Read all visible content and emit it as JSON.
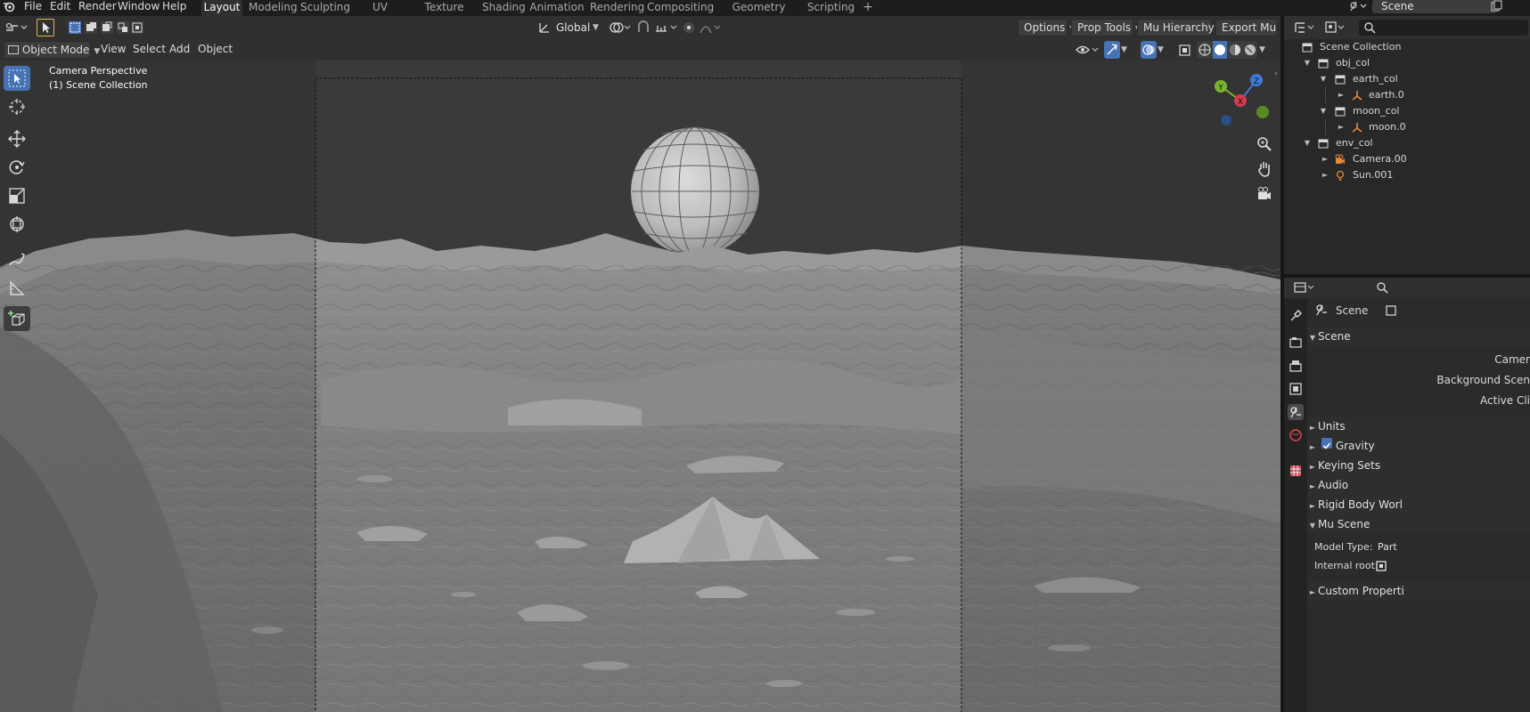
{
  "app": {
    "menu": [
      "File",
      "Edit",
      "Render",
      "Window",
      "Help"
    ],
    "workspace_tabs": [
      "Layout",
      "Modeling",
      "Sculpting",
      "UV Editing",
      "Texture Paint",
      "Shading",
      "Animation",
      "Rendering",
      "Compositing",
      "Geometry Nodes",
      "Scripting"
    ],
    "active_tab": "Layout",
    "add_tab_label": "+",
    "scene_name": "Scene"
  },
  "header": {
    "orientation": "Global",
    "right_buttons": [
      "Options",
      "Prop Tools",
      "Mu Hierarchy",
      "Export Mu"
    ]
  },
  "viewport_header": {
    "mode": "Object Mode",
    "menus": [
      "View",
      "Select",
      "Add",
      "Object"
    ]
  },
  "viewport": {
    "view_name": "Camera Perspective",
    "collection": "(1) Scene Collection",
    "gizmo": {
      "x": "X",
      "y": "Y",
      "z": "Z"
    }
  },
  "outliner": {
    "root": "Scene Collection",
    "items": [
      {
        "label": "obj_col",
        "type": "collection",
        "expanded": true
      },
      {
        "label": "earth_col",
        "type": "collection",
        "expanded": true
      },
      {
        "label": "earth.0",
        "type": "empty",
        "expanded": false
      },
      {
        "label": "moon_col",
        "type": "collection",
        "expanded": true
      },
      {
        "label": "moon.0",
        "type": "empty",
        "expanded": false
      },
      {
        "label": "env_col",
        "type": "collection",
        "expanded": true
      },
      {
        "label": "Camera.00",
        "type": "camera",
        "expanded": false
      },
      {
        "label": "Sun.001",
        "type": "light",
        "expanded": false
      }
    ]
  },
  "properties": {
    "context": "Scene",
    "section_scene": "Scene",
    "fields": {
      "camera": "Camer",
      "background_scene": "Background Scen",
      "active_clip": "Active Cli"
    },
    "sections": [
      "Units",
      "Gravity",
      "Keying Sets",
      "Audio",
      "Rigid Body Worl",
      "Mu Scene"
    ],
    "gravity_checked": true,
    "mu_scene": {
      "model_type_label": "Model Type:",
      "model_type_value": "Part",
      "internal_root_label": "Internal root:"
    },
    "custom_properties": "Custom Properti"
  }
}
